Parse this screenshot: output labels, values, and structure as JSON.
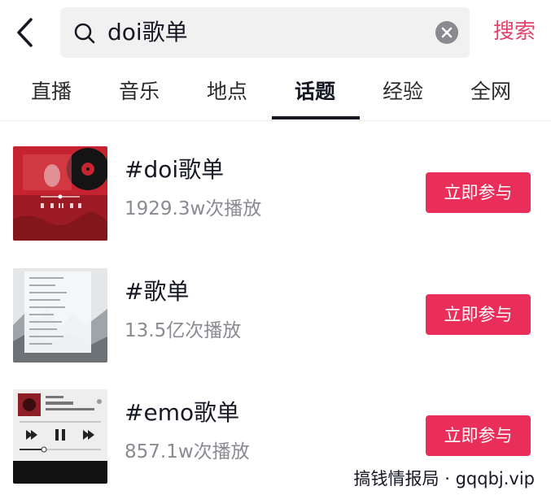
{
  "header": {
    "query": "doi歌单",
    "search_label": "搜索"
  },
  "tabs": [
    {
      "label": "直播"
    },
    {
      "label": "音乐"
    },
    {
      "label": "地点"
    },
    {
      "label": "话题",
      "active": true
    },
    {
      "label": "经验"
    },
    {
      "label": "全网"
    }
  ],
  "results": [
    {
      "title": "#doi歌单",
      "stats": "1929.3w次播放",
      "action": "立即参与"
    },
    {
      "title": "#歌单",
      "stats": "13.5亿次播放",
      "action": "立即参与"
    },
    {
      "title": "#emo歌单",
      "stats": "857.1w次播放",
      "action": "立即参与"
    }
  ],
  "watermark": "搞钱情报局 · gqqbj.vip",
  "colors": {
    "accent": "#ea2e5a",
    "accent_text": "#e0446a"
  }
}
